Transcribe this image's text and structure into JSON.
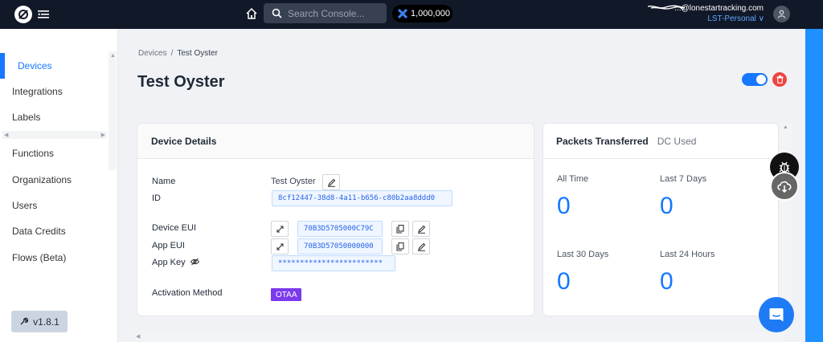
{
  "topbar": {
    "search_placeholder": "Search Console...",
    "dc_balance": "1,000,000",
    "user_email": "...@lonestartracking.com",
    "org_name": "LST-Personal ∨"
  },
  "sidebar": {
    "items": [
      {
        "label": "Devices"
      },
      {
        "label": "Integrations"
      },
      {
        "label": "Labels"
      },
      {
        "label": "Functions"
      },
      {
        "label": "Organizations"
      },
      {
        "label": "Users"
      },
      {
        "label": "Data Credits"
      },
      {
        "label": "Flows (Beta)"
      }
    ],
    "version": "v1.8.1"
  },
  "breadcrumb": {
    "parent": "Devices",
    "separator": "/",
    "current": "Test Oyster"
  },
  "page": {
    "title": "Test Oyster"
  },
  "details": {
    "title": "Device Details",
    "name_label": "Name",
    "name_value": "Test Oyster",
    "id_label": "ID",
    "id_value": "8cf12447-38d8-4a11-b656-c80b2aa8ddd0",
    "deveui_label": "Device EUI",
    "deveui_value": "70B3D5705000C79C",
    "appeui_label": "App EUI",
    "appeui_value": "70B3D57050000000",
    "appkey_label": "App Key",
    "appkey_value": "************************",
    "activation_label": "Activation Method",
    "activation_value": "OTAA"
  },
  "packets": {
    "tab_active": "Packets Transferred",
    "tab_other": "DC Used",
    "stats": [
      {
        "label": "All Time",
        "value": "0"
      },
      {
        "label": "Last 7 Days",
        "value": "0"
      },
      {
        "label": "Last 30 Days",
        "value": "0"
      },
      {
        "label": "Last 24 Hours",
        "value": "0"
      }
    ]
  },
  "colors": {
    "accent": "#1677ff",
    "topbar": "#111827",
    "danger": "#ef4444",
    "otaa": "#7c3aed"
  },
  "icons": [
    "logo-icon",
    "menu-icon",
    "home-icon",
    "search-icon",
    "dc-icon",
    "avatar-icon",
    "edit-icon",
    "expand-icon",
    "copy-icon",
    "eye-off-icon",
    "trash-icon",
    "bug-icon",
    "cloud-download-icon",
    "chat-icon",
    "wrench-icon"
  ]
}
